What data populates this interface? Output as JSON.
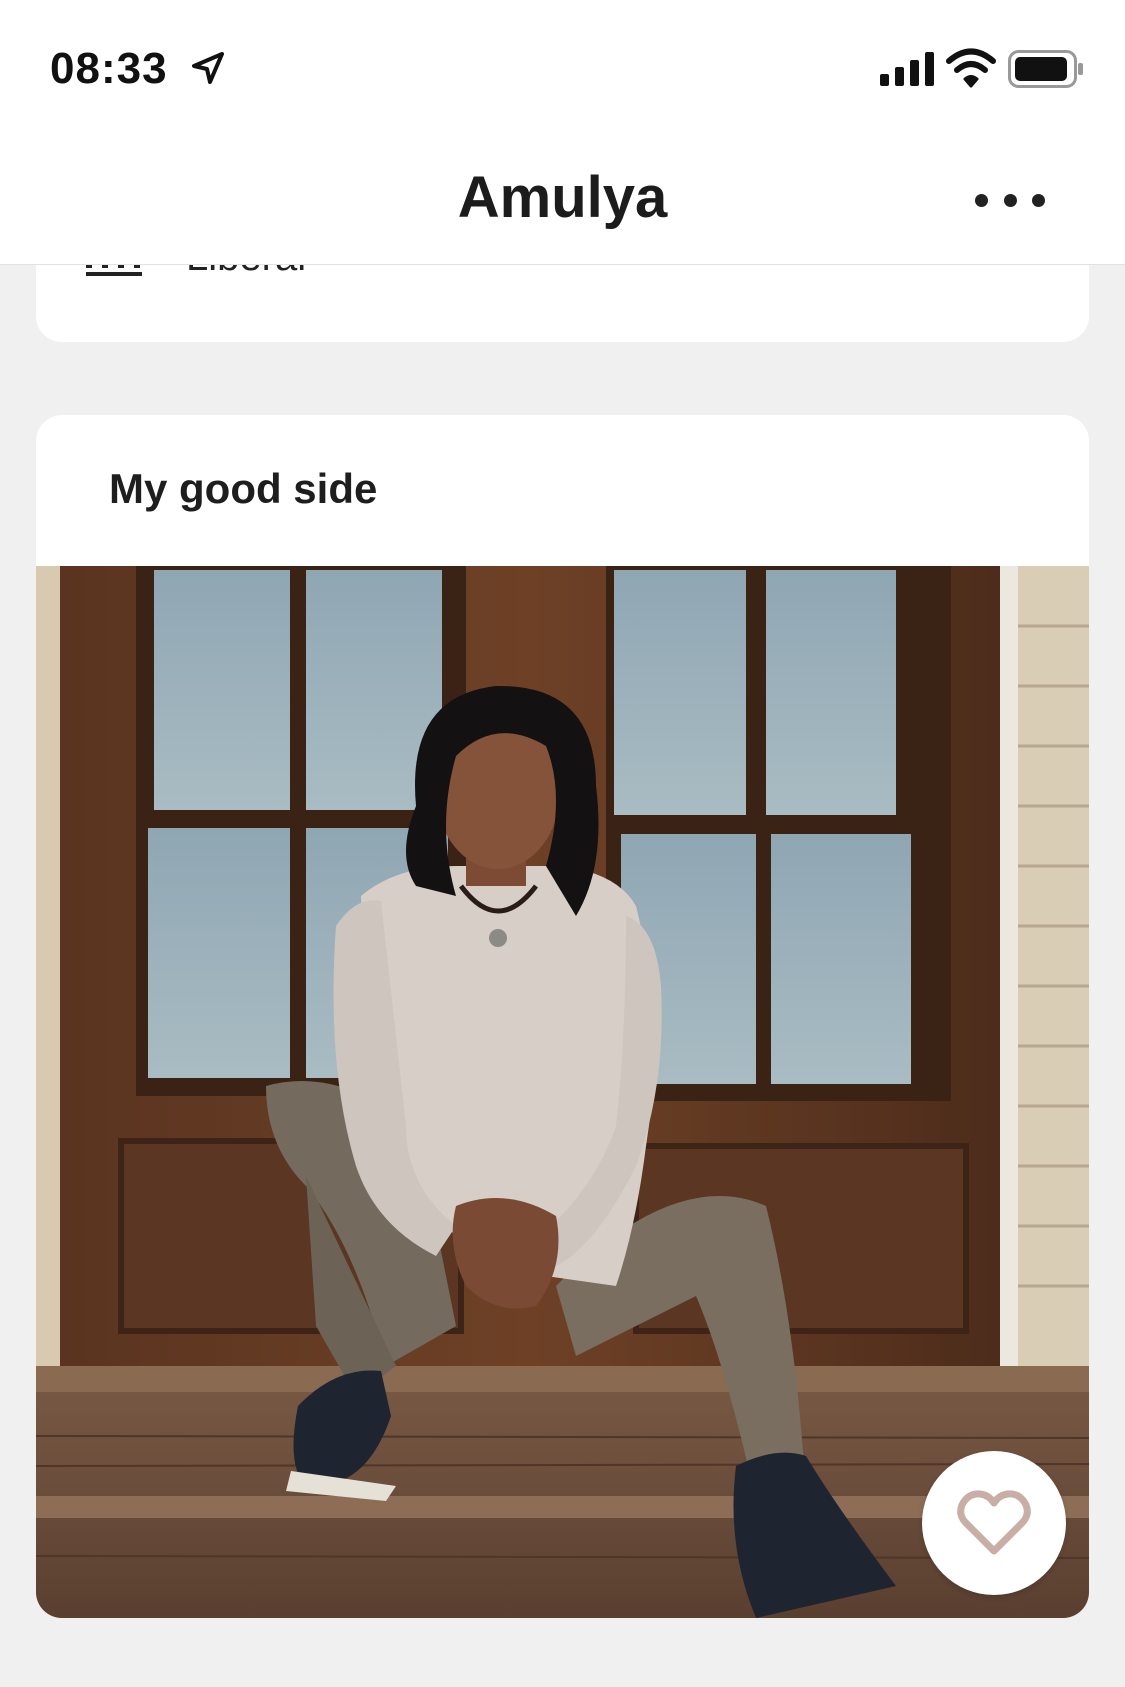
{
  "status_bar": {
    "time": "08:33",
    "icons": [
      "location-arrow-icon",
      "cellular-signal-icon",
      "wifi-icon",
      "battery-icon"
    ]
  },
  "nav": {
    "title": "Amulya",
    "more_icon": "more-horizontal-icon"
  },
  "previous_card": {
    "partial_text": "Liberal",
    "icon": "politics-icon"
  },
  "photo_card": {
    "prompt": "My good side",
    "photo_description": "",
    "like_icon": "heart-icon"
  },
  "colors": {
    "background": "#f0f0f0",
    "card": "#ffffff",
    "heart_stroke": "#c9aea5"
  }
}
